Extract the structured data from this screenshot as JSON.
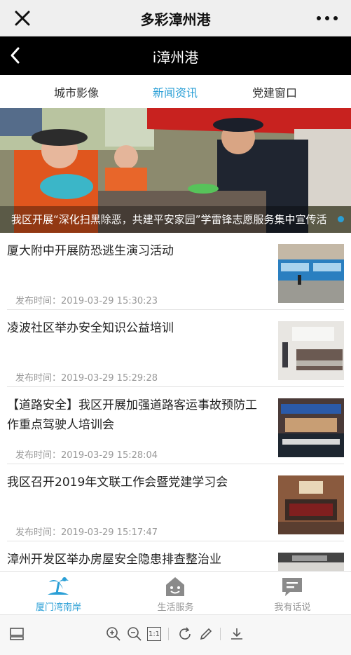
{
  "wechat": {
    "title": "多彩漳州港"
  },
  "appbar": {
    "title": "i漳州港"
  },
  "tabs": [
    {
      "label": "城市影像",
      "active": false
    },
    {
      "label": "新闻资讯",
      "active": true
    },
    {
      "label": "党建窗口",
      "active": false
    }
  ],
  "banner": {
    "caption": "我区开展“深化扫黑除恶，共建平安家园”学雷锋志愿服务集中宣传活"
  },
  "news": [
    {
      "headline": "厦大附中开展防恐逃生演习活动",
      "date": "发布时间：2019-03-29 15:30:23"
    },
    {
      "headline": "凌波社区举办安全知识公益培训",
      "date": "发布时间：2019-03-29 15:29:28"
    },
    {
      "headline": "【道路安全】我区开展加强道路客运事故预防工作重点驾驶人培训会",
      "date": "发布时间：2019-03-29 15:28:04"
    },
    {
      "headline": "我区召开2019年文联工作会暨党建学习会",
      "date": "发布时间：2019-03-29 15:17:47"
    },
    {
      "headline": "漳州开发区举办房屋安全隐患排查整治业",
      "date": ""
    }
  ],
  "bottom_nav": [
    {
      "label": "厦门湾南岸",
      "icon": "island-icon",
      "active": true
    },
    {
      "label": "生活服务",
      "icon": "house-icon",
      "active": false
    },
    {
      "label": "我有话说",
      "icon": "chat-icon",
      "active": false
    }
  ],
  "viewer": {
    "zoom_reset_label": "1:1"
  },
  "colors": {
    "accent": "#2a9fd6",
    "appbar": "#000000",
    "caption_bg": "rgba(0,0,0,0.35)"
  }
}
